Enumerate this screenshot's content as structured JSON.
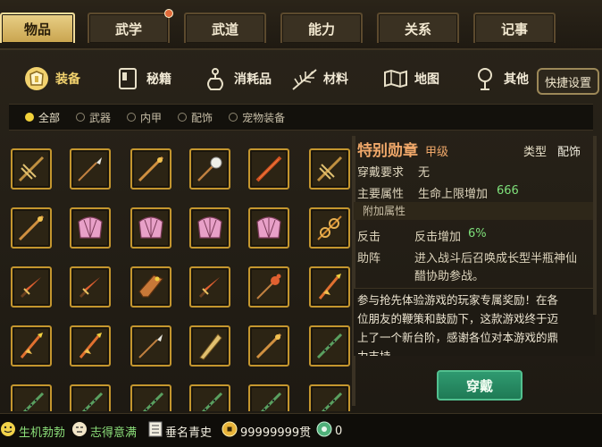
{
  "top_tabs": [
    {
      "label": "物品",
      "active": true
    },
    {
      "label": "武学",
      "badge": true
    },
    {
      "label": "武道"
    },
    {
      "label": "能力"
    },
    {
      "label": "关系"
    },
    {
      "label": "记事"
    }
  ],
  "sub_tabs": [
    {
      "label": "装备",
      "icon": "armor-icon",
      "active": true
    },
    {
      "label": "秘籍",
      "icon": "book-icon"
    },
    {
      "label": "消耗品",
      "icon": "gourd-icon"
    },
    {
      "label": "材料",
      "icon": "herb-icon"
    },
    {
      "label": "地图",
      "icon": "map-icon"
    },
    {
      "label": "其他",
      "icon": "lamp-icon"
    }
  ],
  "quick_settings": "快捷设置",
  "filters": [
    {
      "label": "全部",
      "selected": true
    },
    {
      "label": "武器"
    },
    {
      "label": "内甲"
    },
    {
      "label": "配饰"
    },
    {
      "label": "宠物装备"
    }
  ],
  "grid_items": [
    [
      "crossbow-icon",
      "spear-icon",
      "staff-icon",
      "mace-icon",
      "rod-icon",
      "crossbow-icon"
    ],
    [
      "staff-icon",
      "fan-icon",
      "fan-icon",
      "fan-icon",
      "fan-icon",
      "ring-icon"
    ],
    [
      "dagger-icon",
      "dagger-icon",
      "coffin-icon",
      "dagger-icon",
      "gourd-icon",
      "brush-icon"
    ],
    [
      "brush-icon",
      "brush-icon",
      "spear-icon",
      "quiver-icon",
      "staff-icon",
      "flute-icon"
    ],
    [
      "flute-icon",
      "flute-icon",
      "flute-icon",
      "flute-icon",
      "flute-icon",
      "flute-icon"
    ]
  ],
  "detail": {
    "name": "特别勋章",
    "grade": "甲级",
    "type_label": "类型",
    "type_value": "配饰",
    "req_label": "穿戴要求",
    "req_value": "无",
    "main_attr_label": "主要属性",
    "main_attr_text": "生命上限增加",
    "main_attr_value": "666",
    "extra_header": "附加属性",
    "counter_label": "反击",
    "counter_text": "反击增加",
    "counter_value": "6%",
    "assist_label": "助阵",
    "assist_text_1": "进入战斗后召唤成长型半瓶神仙",
    "assist_text_2": "醋协助参战。",
    "desc_1": "参与抢先体验游戏的玩家专属奖励！在各",
    "desc_2": "位朋友的鞭策和鼓励下，这款游戏终于迈",
    "desc_3": "上了一个新台阶，感谢各位对本游戏的鼎",
    "desc_4": "力支持。",
    "equip_button": "穿戴"
  },
  "status": {
    "mood1": "生机勃勃",
    "mood2": "志得意满",
    "fame": "垂名青史",
    "money": "99999999贯",
    "gems": "0"
  }
}
